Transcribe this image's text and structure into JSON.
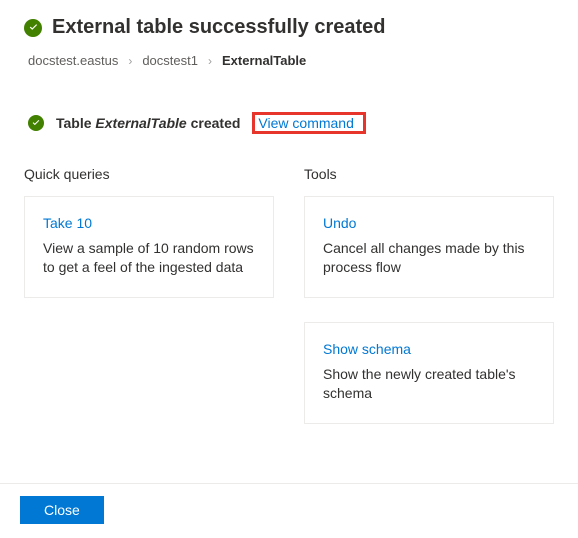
{
  "header": {
    "title": "External table successfully created"
  },
  "breadcrumb": {
    "items": [
      "docstest.eastus",
      "docstest1",
      "ExternalTable"
    ]
  },
  "status": {
    "prefix": "Table ",
    "tableName": "ExternalTable",
    "suffix": " created",
    "viewCommand": "View command"
  },
  "quickQueries": {
    "heading": "Quick queries",
    "cards": [
      {
        "title": "Take 10",
        "desc": "View a sample of 10 random rows to get a feel of the ingested data"
      }
    ]
  },
  "tools": {
    "heading": "Tools",
    "cards": [
      {
        "title": "Undo",
        "desc": "Cancel all changes made by this process flow"
      },
      {
        "title": "Show schema",
        "desc": "Show the newly created table's schema"
      }
    ]
  },
  "footer": {
    "close": "Close"
  },
  "colors": {
    "link": "#0078d4",
    "success": "#428000",
    "highlight": "#e8352c"
  }
}
